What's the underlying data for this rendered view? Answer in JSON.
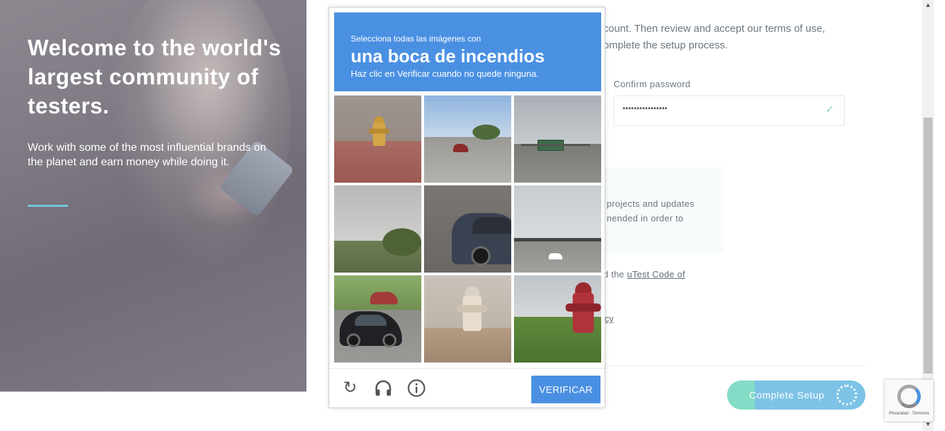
{
  "hero": {
    "title": "Welcome to the world's largest community of testers.",
    "subtitle": "Work with some of the most influential brands on the planet and earn money while doing it."
  },
  "form": {
    "intro": "count. Then review and accept our terms of use, omplete the setup process.",
    "confirm_password_label": "Confirm password",
    "confirm_password_value": "••••••••••••••••",
    "info_text": "projects and updates nended in order to",
    "coc_prefix": "d the ",
    "coc_link": "uTest Code of",
    "privacy_link": "cy",
    "complete_label": "Complete Setup"
  },
  "captcha": {
    "instruction_line1": "Selecciona todas las imágenes con",
    "instruction_target": "una boca de incendios",
    "instruction_line3": "Haz clic en Verificar cuando no quede ninguna.",
    "verify_label": "VERIFICAR",
    "icons": {
      "reload": "reload-icon",
      "audio": "headphones-icon",
      "info": "info-icon"
    }
  },
  "recaptcha_badge": {
    "text": "Privacidad - Términos"
  },
  "colors": {
    "captcha_blue": "#4a90e2",
    "accent_teal": "#72c9db",
    "button_blue": "#7dc3e6",
    "button_green": "#85dcc6"
  }
}
